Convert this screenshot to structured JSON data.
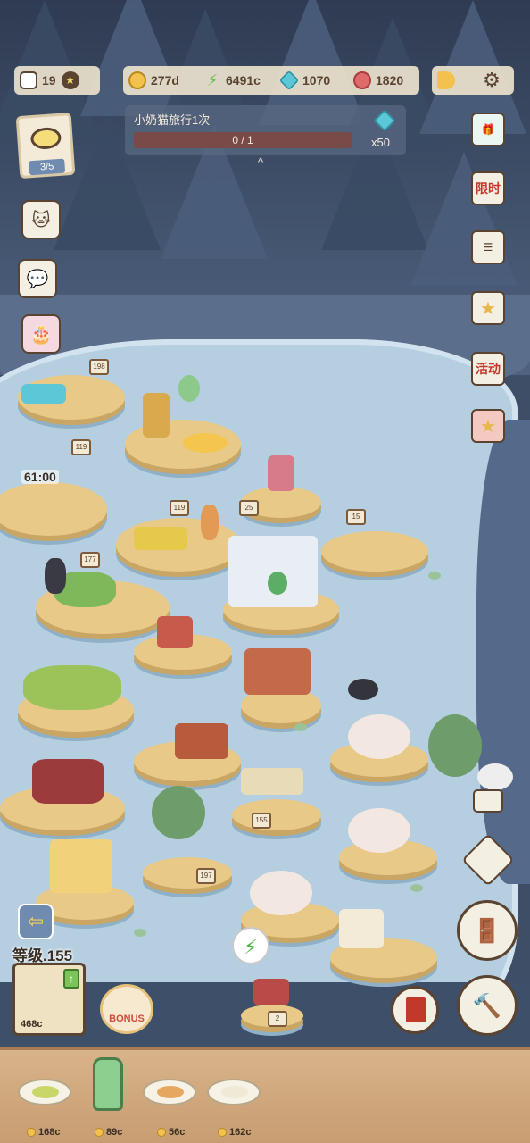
{
  "hud": {
    "cats": "19",
    "coins": "277d",
    "energy": "6491c",
    "gems": "1070",
    "candy": "1820"
  },
  "quest": {
    "title": "小奶猫旅行1次",
    "progress": "0 / 1",
    "progress_value": 0,
    "reward": "x50",
    "reward_icon": "gem-icon"
  },
  "soup": {
    "count": "3/5"
  },
  "timer": "61:00",
  "right_menu": [
    {
      "name": "gift-box-icon",
      "label": ""
    },
    {
      "name": "limited-time-icon",
      "label": "限时"
    },
    {
      "name": "task-list-icon",
      "label": ""
    },
    {
      "name": "star-badge-icon",
      "label": ""
    },
    {
      "name": "event-icon",
      "label": "活动"
    },
    {
      "name": "star-card-icon",
      "label": ""
    }
  ],
  "level": {
    "label": "等级.155",
    "upgrade_cost": "468c"
  },
  "bonus": {
    "label": "BONUS"
  },
  "shelf": [
    {
      "name": "soup-plate",
      "price": "168c"
    },
    {
      "name": "green-bottle",
      "price": "89c"
    },
    {
      "name": "fried-plate",
      "price": "56c"
    },
    {
      "name": "rice-plate",
      "price": "162c"
    }
  ],
  "signs": [
    "198",
    "119",
    "119",
    "177",
    "25",
    "15",
    "155",
    "197",
    "2"
  ],
  "colors": {
    "lake": "#b6cfe0",
    "forest": "#3a4a64",
    "hud_bg": "#ebe2cd",
    "accent_red": "#c0392b",
    "energy_green": "#5fbf45"
  }
}
